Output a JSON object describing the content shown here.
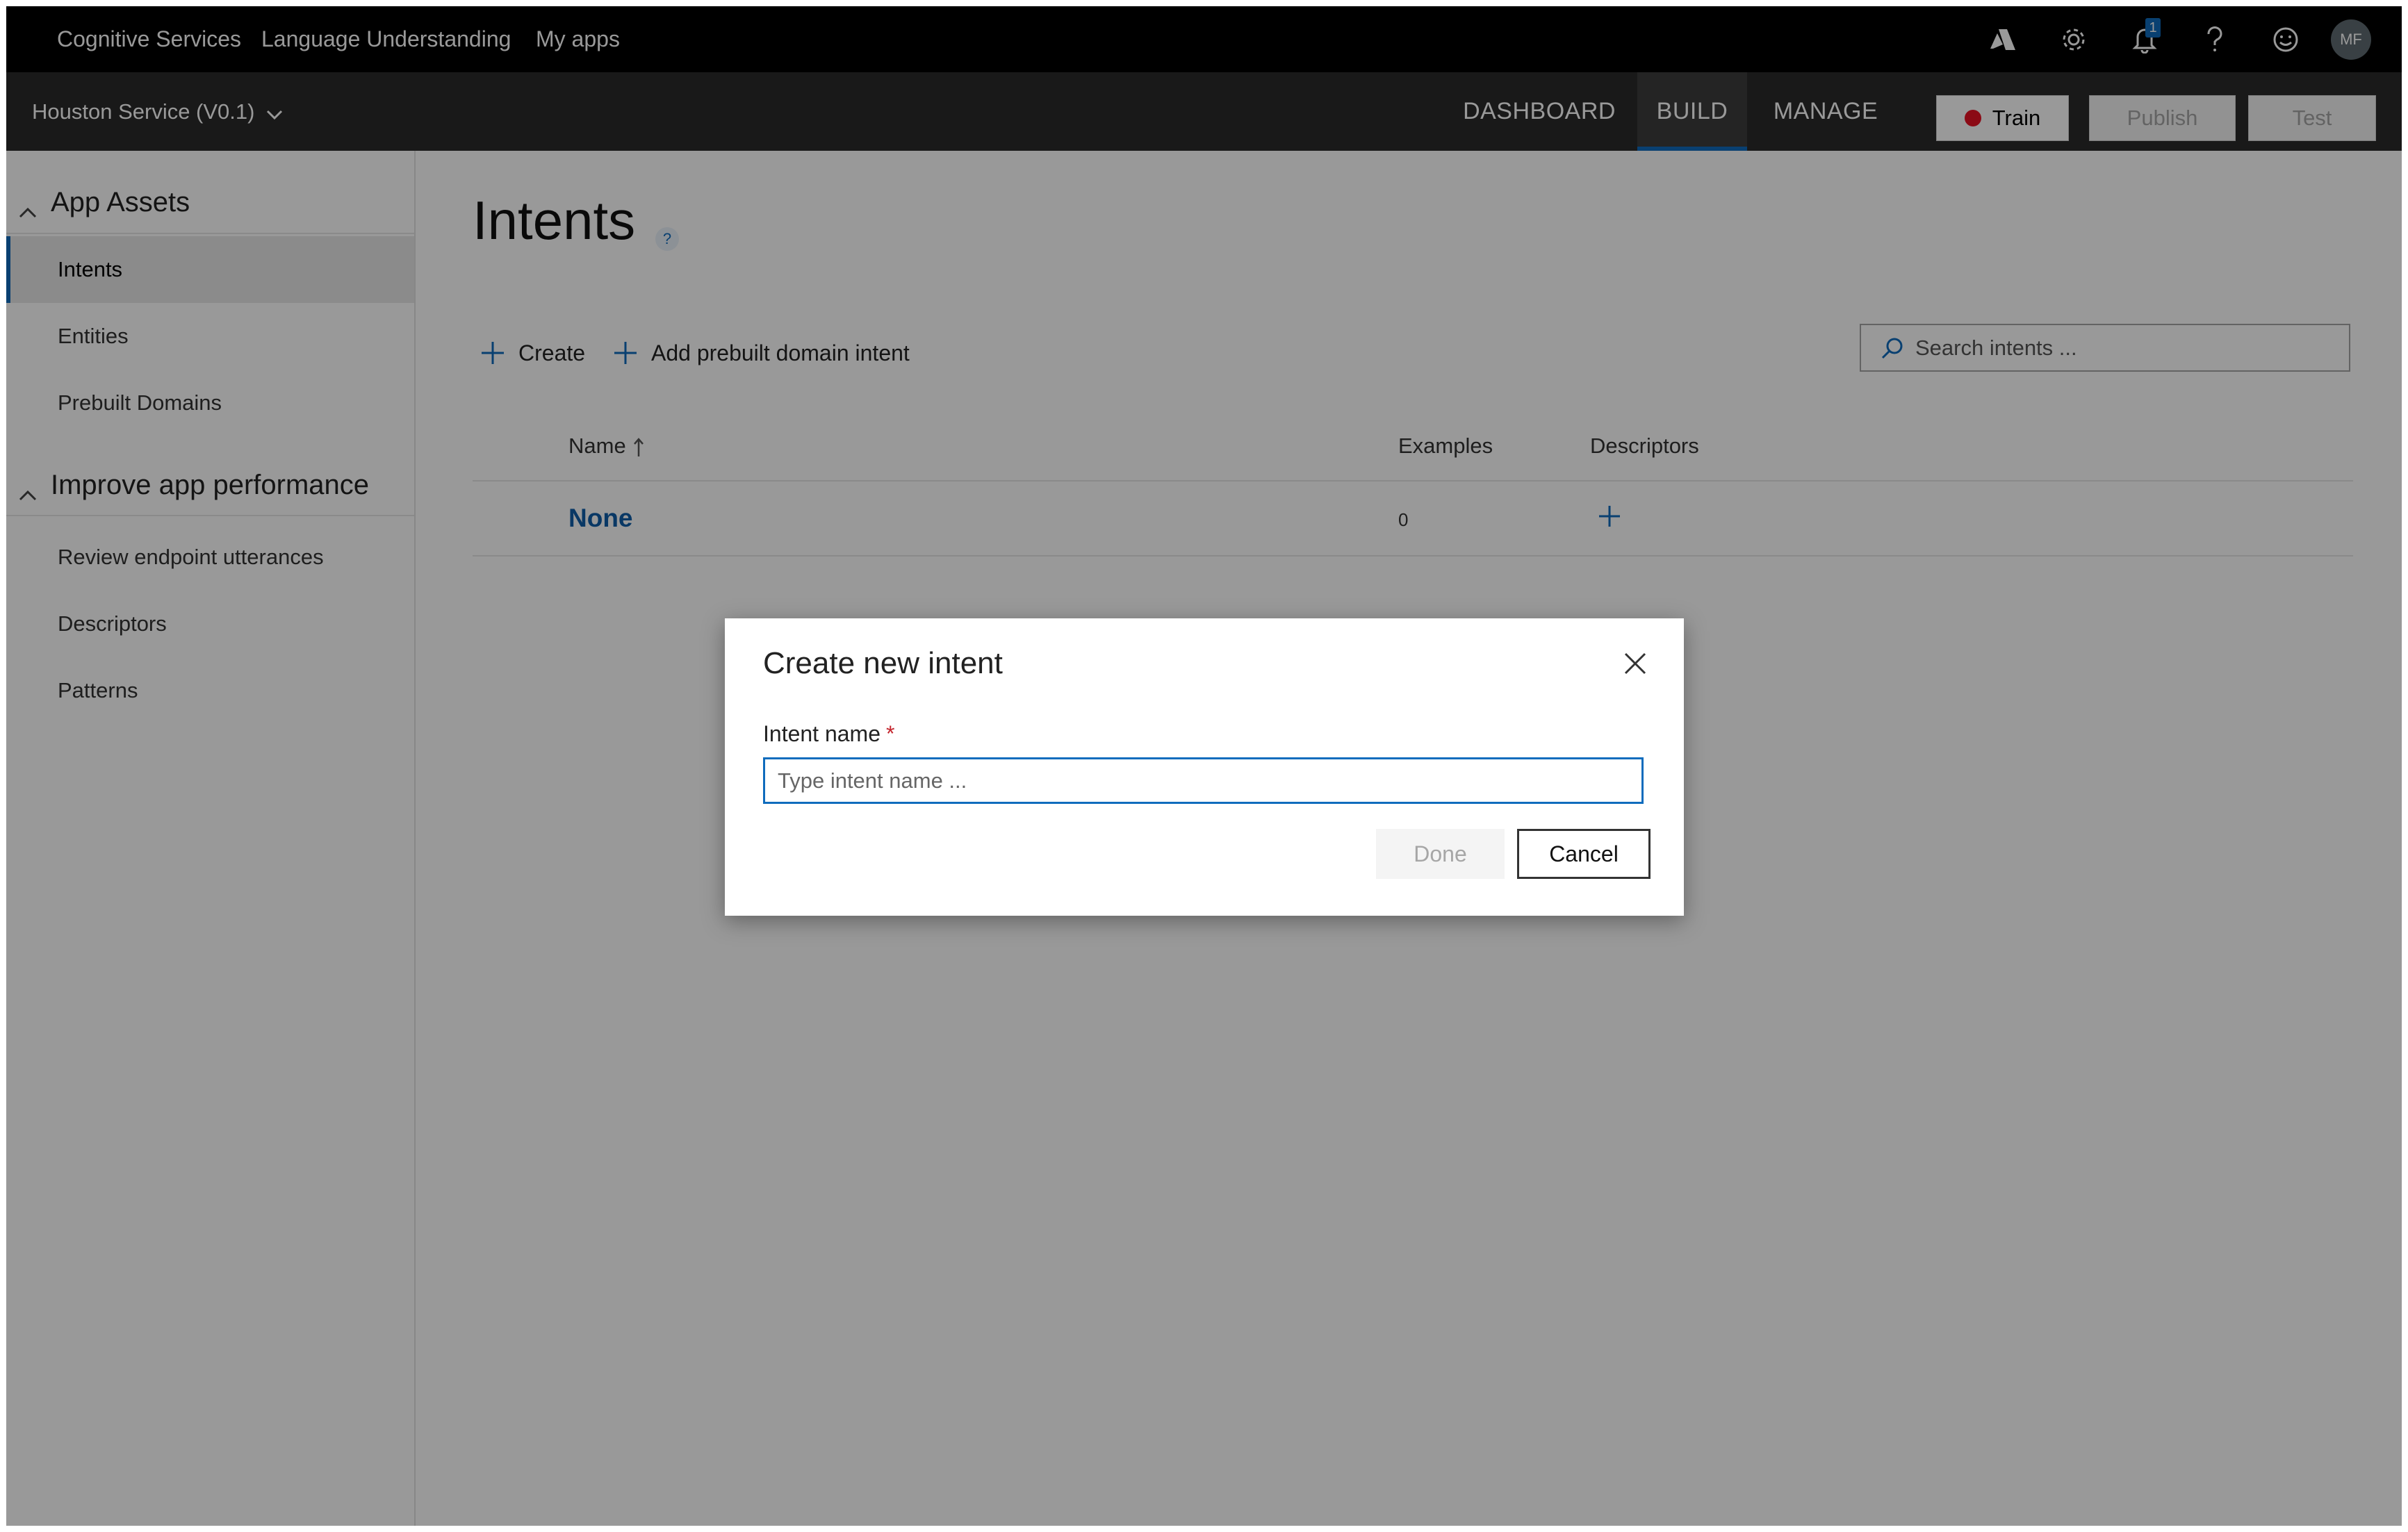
{
  "topbar": {
    "brand_items": [
      "Cognitive Services",
      "Language Understanding",
      "My apps"
    ],
    "notification_count": "1",
    "user_initials": "MF"
  },
  "appbar": {
    "app_name": "Houston Service (V0.1)",
    "tabs": [
      {
        "label": "DASHBOARD",
        "active": false
      },
      {
        "label": "BUILD",
        "active": true
      },
      {
        "label": "MANAGE",
        "active": false
      }
    ],
    "train_label": "Train",
    "publish_label": "Publish",
    "test_label": "Test"
  },
  "sidebar": {
    "sections": [
      {
        "title": "App Assets",
        "items": [
          {
            "label": "Intents",
            "active": true
          },
          {
            "label": "Entities",
            "active": false
          },
          {
            "label": "Prebuilt Domains",
            "active": false
          }
        ]
      },
      {
        "title": "Improve app performance",
        "items": [
          {
            "label": "Review endpoint utterances",
            "active": false
          },
          {
            "label": "Descriptors",
            "active": false
          },
          {
            "label": "Patterns",
            "active": false
          }
        ]
      }
    ]
  },
  "main": {
    "title": "Intents",
    "help_glyph": "?",
    "create_label": "Create",
    "add_prebuilt_label": "Add prebuilt domain intent",
    "search_placeholder": "Search intents ...",
    "columns": {
      "name": "Name",
      "examples": "Examples",
      "descriptors": "Descriptors"
    },
    "rows": [
      {
        "name": "None",
        "examples": "0"
      }
    ]
  },
  "dialog": {
    "title": "Create new intent",
    "field_label": "Intent name",
    "required_mark": "*",
    "input_placeholder": "Type intent name ...",
    "input_value": "",
    "done_label": "Done",
    "cancel_label": "Cancel"
  },
  "colors": {
    "accent": "#0f6cbd",
    "train_dot": "#e81123",
    "overlay": "rgba(0,0,0,0.40)"
  }
}
